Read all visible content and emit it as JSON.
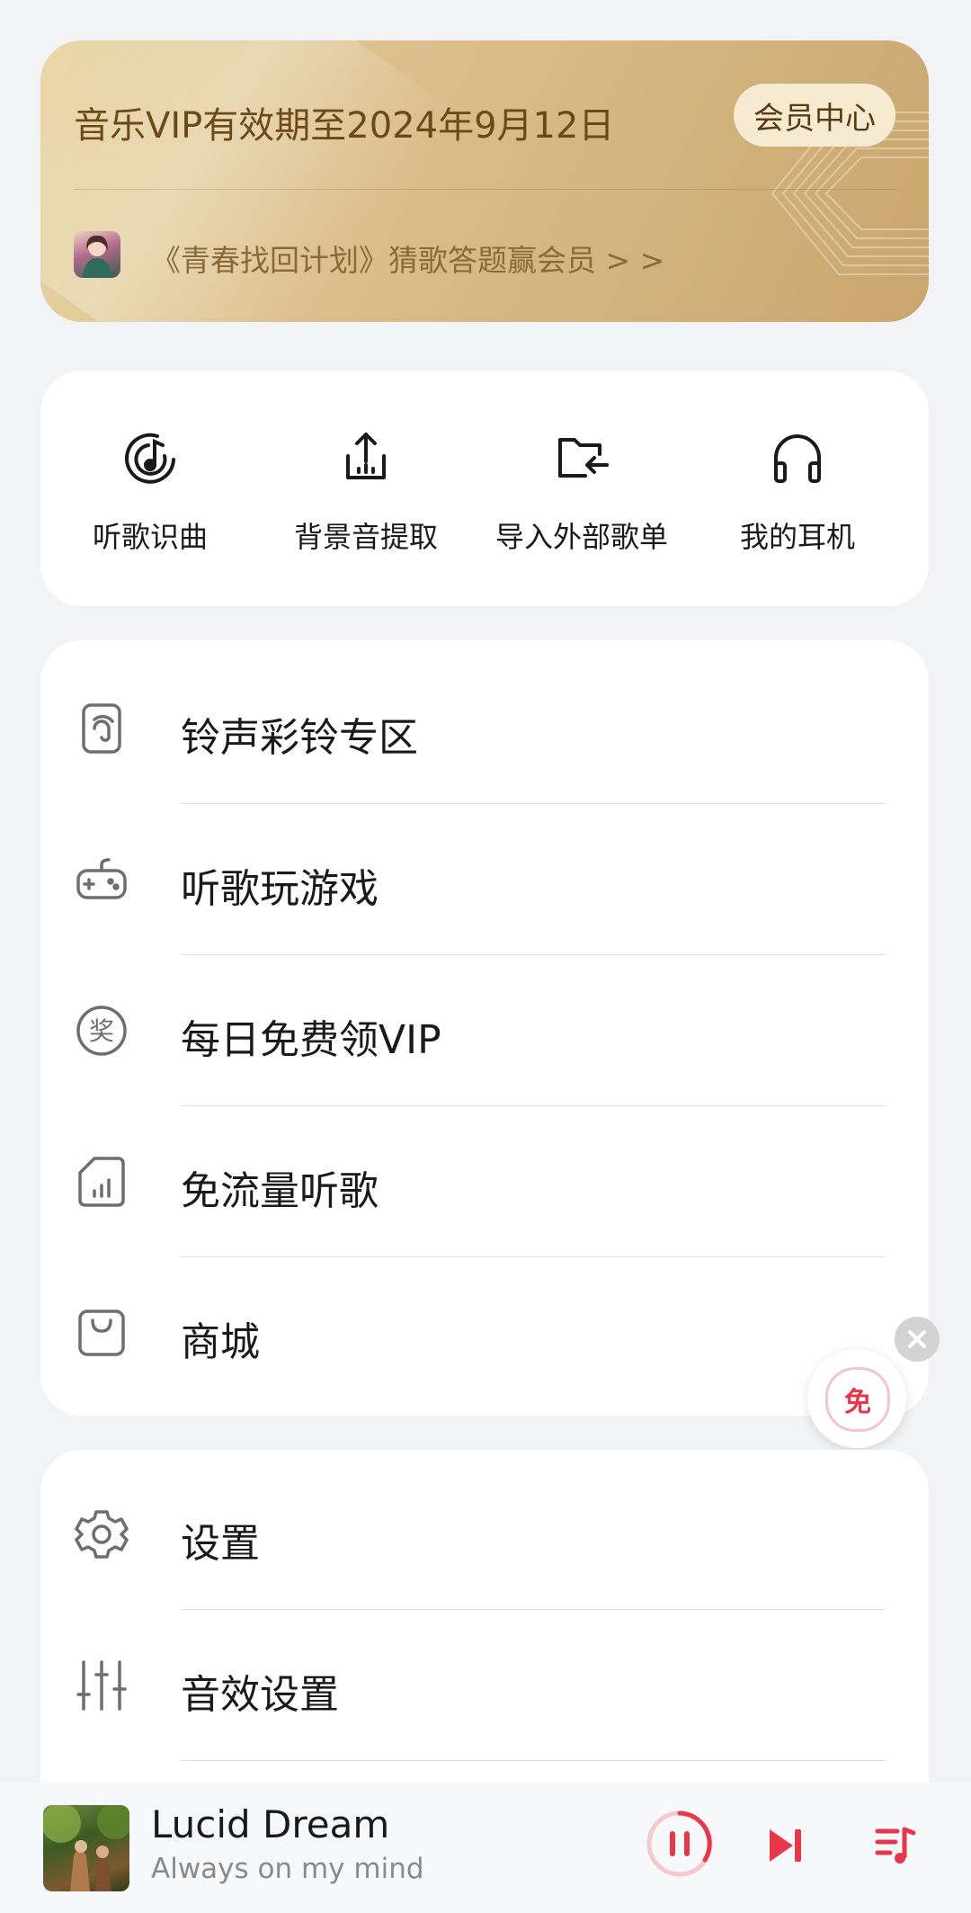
{
  "vip": {
    "title": "音乐VIP有效期至2024年9月12日",
    "center_button": "会员中心",
    "promo": "《青春找回计划》猜歌答题赢会员 > >"
  },
  "tools": [
    {
      "label": "听歌识曲",
      "icon": "music-recognition-icon"
    },
    {
      "label": "背景音提取",
      "icon": "share-upload-icon"
    },
    {
      "label": "导入外部歌单",
      "icon": "folder-import-icon"
    },
    {
      "label": "我的耳机",
      "icon": "headphones-icon"
    }
  ],
  "services": [
    {
      "label": "铃声彩铃专区",
      "icon": "ringtone-icon"
    },
    {
      "label": "听歌玩游戏",
      "icon": "gamepad-icon"
    },
    {
      "label": "每日免费领VIP",
      "icon": "award-icon"
    },
    {
      "label": "免流量听歌",
      "icon": "sim-data-icon"
    },
    {
      "label": "商城",
      "icon": "shopping-bag-icon"
    }
  ],
  "settings": [
    {
      "label": "设置",
      "icon": "gear-icon"
    },
    {
      "label": "音效设置",
      "icon": "equalizer-icon"
    }
  ],
  "floating_badge": "免",
  "player": {
    "title": "Lucid Dream",
    "subtitle": "Always on my mind"
  },
  "colors": {
    "accent": "#e6384c",
    "vip_gold": "#d2b27d"
  }
}
